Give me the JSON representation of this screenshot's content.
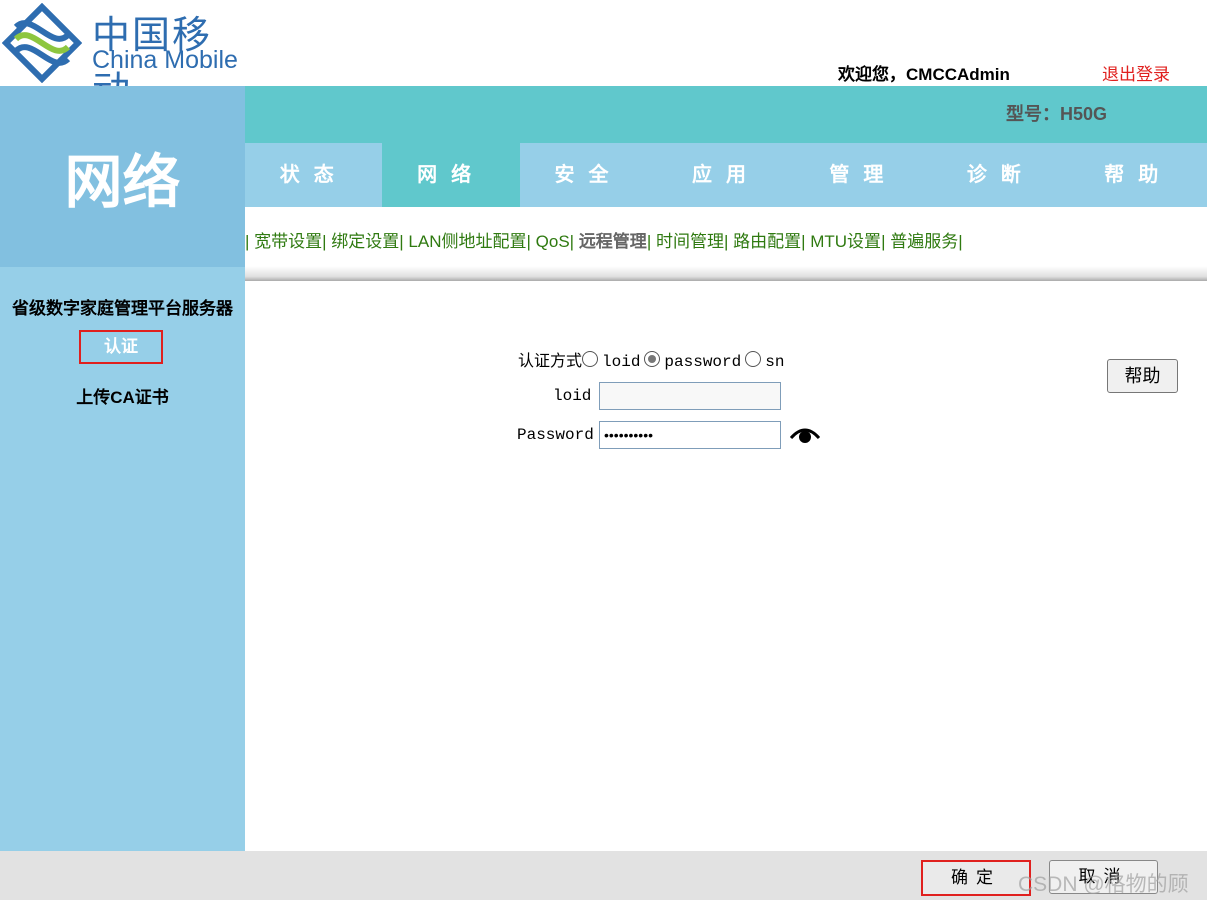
{
  "brand": {
    "cn": "中国移动",
    "en": "China Mobile"
  },
  "header": {
    "welcome": "欢迎您，CMCCAdmin",
    "logout": "退出登录",
    "model": "型号：H50G"
  },
  "section_title": "网络",
  "tabs": [
    "状态",
    "网络",
    "安全",
    "应用",
    "管理",
    "诊断",
    "帮助"
  ],
  "subnav": [
    "宽带设置",
    "绑定设置",
    "LAN侧地址配置",
    "QoS",
    "远程管理",
    "时间管理",
    "路由配置",
    "MTU设置",
    "普遍服务"
  ],
  "sidebar": {
    "title": "省级数字家庭管理平台服务器",
    "items": [
      "认证",
      "上传CA证书"
    ]
  },
  "form": {
    "auth_label": "认证方式",
    "options": [
      "loid",
      "password",
      "sn"
    ],
    "selected": "password",
    "loid_label": "loid",
    "loid_value": "",
    "password_label": "Password",
    "password_value": "••••••••••"
  },
  "help_button": "帮助",
  "footer": {
    "ok": "确定",
    "cancel": "取消"
  },
  "watermark": "CSDN @格物的顾"
}
